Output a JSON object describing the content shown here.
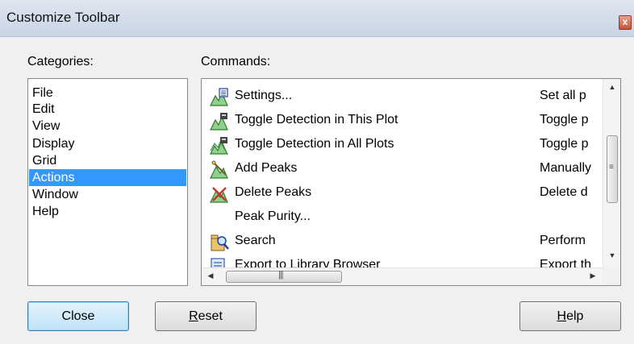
{
  "window": {
    "title": "Customize Toolbar",
    "close_glyph": "x"
  },
  "categories": {
    "label": "Categories:",
    "items": [
      "File",
      "Edit",
      "View",
      "Display",
      "Grid",
      "Actions",
      "Window",
      "Help"
    ],
    "selected": "Actions"
  },
  "commands": {
    "label": "Commands:",
    "items": [
      {
        "name": "Settings...",
        "desc": "Set all p",
        "icon": "settings-icon"
      },
      {
        "name": "Toggle Detection in This Plot",
        "desc": "Toggle p",
        "icon": "toggle-detection-plot-icon"
      },
      {
        "name": "Toggle Detection in All Plots",
        "desc": "Toggle p",
        "icon": "toggle-detection-all-icon"
      },
      {
        "name": "Add Peaks",
        "desc": "Manually",
        "icon": "add-peaks-icon"
      },
      {
        "name": "Delete Peaks",
        "desc": "Delete d",
        "icon": "delete-peaks-icon"
      },
      {
        "name": "Peak Purity...",
        "desc": "",
        "icon": ""
      },
      {
        "name": "Search",
        "desc": "Perform",
        "icon": "search-icon"
      },
      {
        "name": "Export to Library Browser",
        "desc": "Export th",
        "icon": "export-library-icon"
      }
    ],
    "vscroll_position": 0.45
  },
  "buttons": {
    "close": "Close",
    "reset": "Reset",
    "help": "Help"
  },
  "colors": {
    "selection": "#3399ff",
    "default_button": "#bde3f8"
  }
}
